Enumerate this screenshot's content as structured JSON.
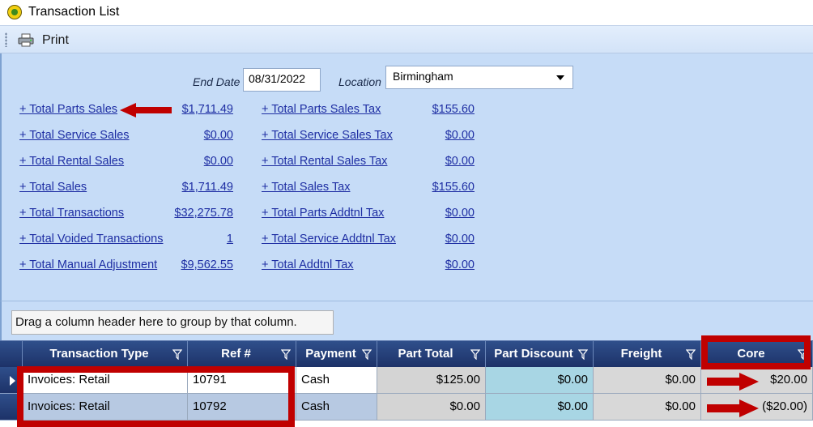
{
  "window": {
    "title": "Transaction List",
    "icon": "app-logo-icon"
  },
  "toolbar": {
    "print_label": "Print",
    "print_icon": "printer-icon"
  },
  "filters": {
    "end_date_label": "End Date",
    "end_date_value": "08/31/2022",
    "location_label": "Location",
    "location_value": "Birmingham"
  },
  "totals_left": [
    {
      "label": "+ Total Parts Sales",
      "value": "$1,711.49"
    },
    {
      "label": "+ Total Service Sales",
      "value": "$0.00"
    },
    {
      "label": "+ Total Rental Sales",
      "value": "$0.00"
    },
    {
      "label": "+ Total Sales",
      "value": "$1,711.49"
    },
    {
      "label": "+ Total Transactions",
      "value": "$32,275.78"
    },
    {
      "label": "+ Total Voided Transactions",
      "value": "1"
    },
    {
      "label": "+ Total Manual Adjustment",
      "value": "$9,562.55"
    }
  ],
  "totals_right": [
    {
      "label": "+ Total Parts Sales Tax",
      "value": "$155.60"
    },
    {
      "label": "+ Total Service Sales Tax",
      "value": "$0.00"
    },
    {
      "label": "+ Total Rental Sales Tax",
      "value": "$0.00"
    },
    {
      "label": "+ Total Sales Tax",
      "value": "$155.60"
    },
    {
      "label": "+ Total Parts Addtnl Tax",
      "value": "$0.00"
    },
    {
      "label": "+ Total Service Addtnl Tax",
      "value": "$0.00"
    },
    {
      "label": "+ Total Addtnl Tax",
      "value": "$0.00"
    }
  ],
  "grid": {
    "group_by_hint": "Drag a column header here to group by that column.",
    "columns": [
      "Transaction Type",
      "Ref #",
      "Payment",
      "Part Total",
      "Part Discount",
      "Freight",
      "Core"
    ],
    "rows": [
      [
        "Invoices: Retail",
        "10791",
        "Cash",
        "$125.00",
        "$0.00",
        "$0.00",
        "$20.00"
      ],
      [
        "Invoices: Retail",
        "10792",
        "Cash",
        "$0.00",
        "$0.00",
        "$0.00",
        "($20.00)"
      ]
    ]
  },
  "colors": {
    "panel_bg": "#c6dcf7",
    "header_bg": "#1d3268",
    "link": "#1e2ea3",
    "annotation_red": "#c00000",
    "discount_cell_bg": "#a8d6e4"
  }
}
